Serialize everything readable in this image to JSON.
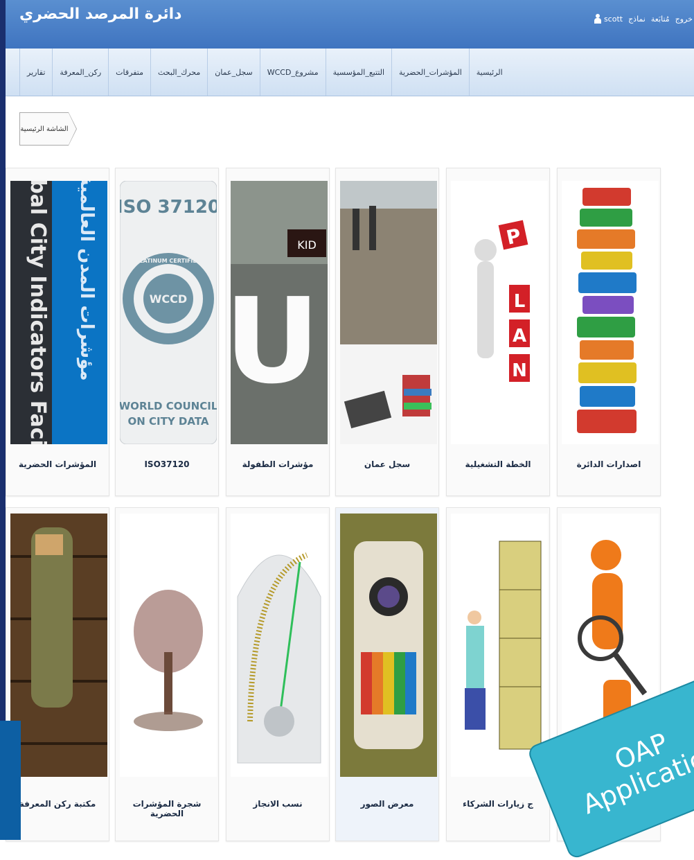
{
  "header": {
    "title": "دائرة المرصد الحضري",
    "username": "scott",
    "links": [
      "نماذج",
      "مُتابَعة",
      "خروج"
    ]
  },
  "nav": {
    "items": [
      "الرئيسية",
      "المؤشرات_الحضرية",
      "التتبع_المؤسسية",
      "مشروع_WCCD",
      "سجل_عمان",
      "محرك_البحث",
      "متفرقات",
      "ركن_المعرفة",
      "تقارير"
    ]
  },
  "breadcrumb": {
    "label": "الشاشة الرئيسية"
  },
  "tiles": [
    {
      "label": "المؤشرات الحضرية",
      "image": "Global City Indicators Facility"
    },
    {
      "label": "ISO37120",
      "image": "ISO 37120 Platinum Certified — World Council on City Data"
    },
    {
      "label": "مؤشرات الطفولة",
      "image": "KID"
    },
    {
      "label": "سجل عمان",
      "image": "city skyline and books"
    },
    {
      "label": "الخطة التشغيلية",
      "image": "PLAN blocks"
    },
    {
      "label": "اصدارات الدائرة",
      "image": "stack of books"
    },
    {
      "label": "مكتبة ركن المعرفة",
      "image": "reader with bookshelves"
    },
    {
      "label": "شجرة المؤشرات الحضرية",
      "image": "tree"
    },
    {
      "label": "نسب الانجاز",
      "image": "gauge"
    },
    {
      "label": "معرض الصور",
      "image": "camera"
    },
    {
      "label": "ج زيارات الشركاء",
      "image": "file cabinet"
    },
    {
      "label": "",
      "image": "magnifier figure"
    }
  ],
  "images": {
    "iso_title": "ISO 37120",
    "iso_badge_top": "PLATINUM CERTIFIED",
    "iso_badge_center": "WCCD",
    "iso_footer_1": "WORLD COUNCIL",
    "iso_footer_2": "ON CITY DATA",
    "kid_letter": "U",
    "kid_tag": "KID",
    "plan_letters": [
      "P",
      "L",
      "A",
      "N"
    ],
    "gci_text": "Global City Indicators Facility",
    "gci_arabic": "مؤشرات المدن العالمية"
  },
  "watermark": {
    "line1": "OAP",
    "line2": "Application"
  },
  "colors": {
    "header": "#3f74c0",
    "navbar": "#d9e7f6",
    "accent": "#38b6cf"
  }
}
